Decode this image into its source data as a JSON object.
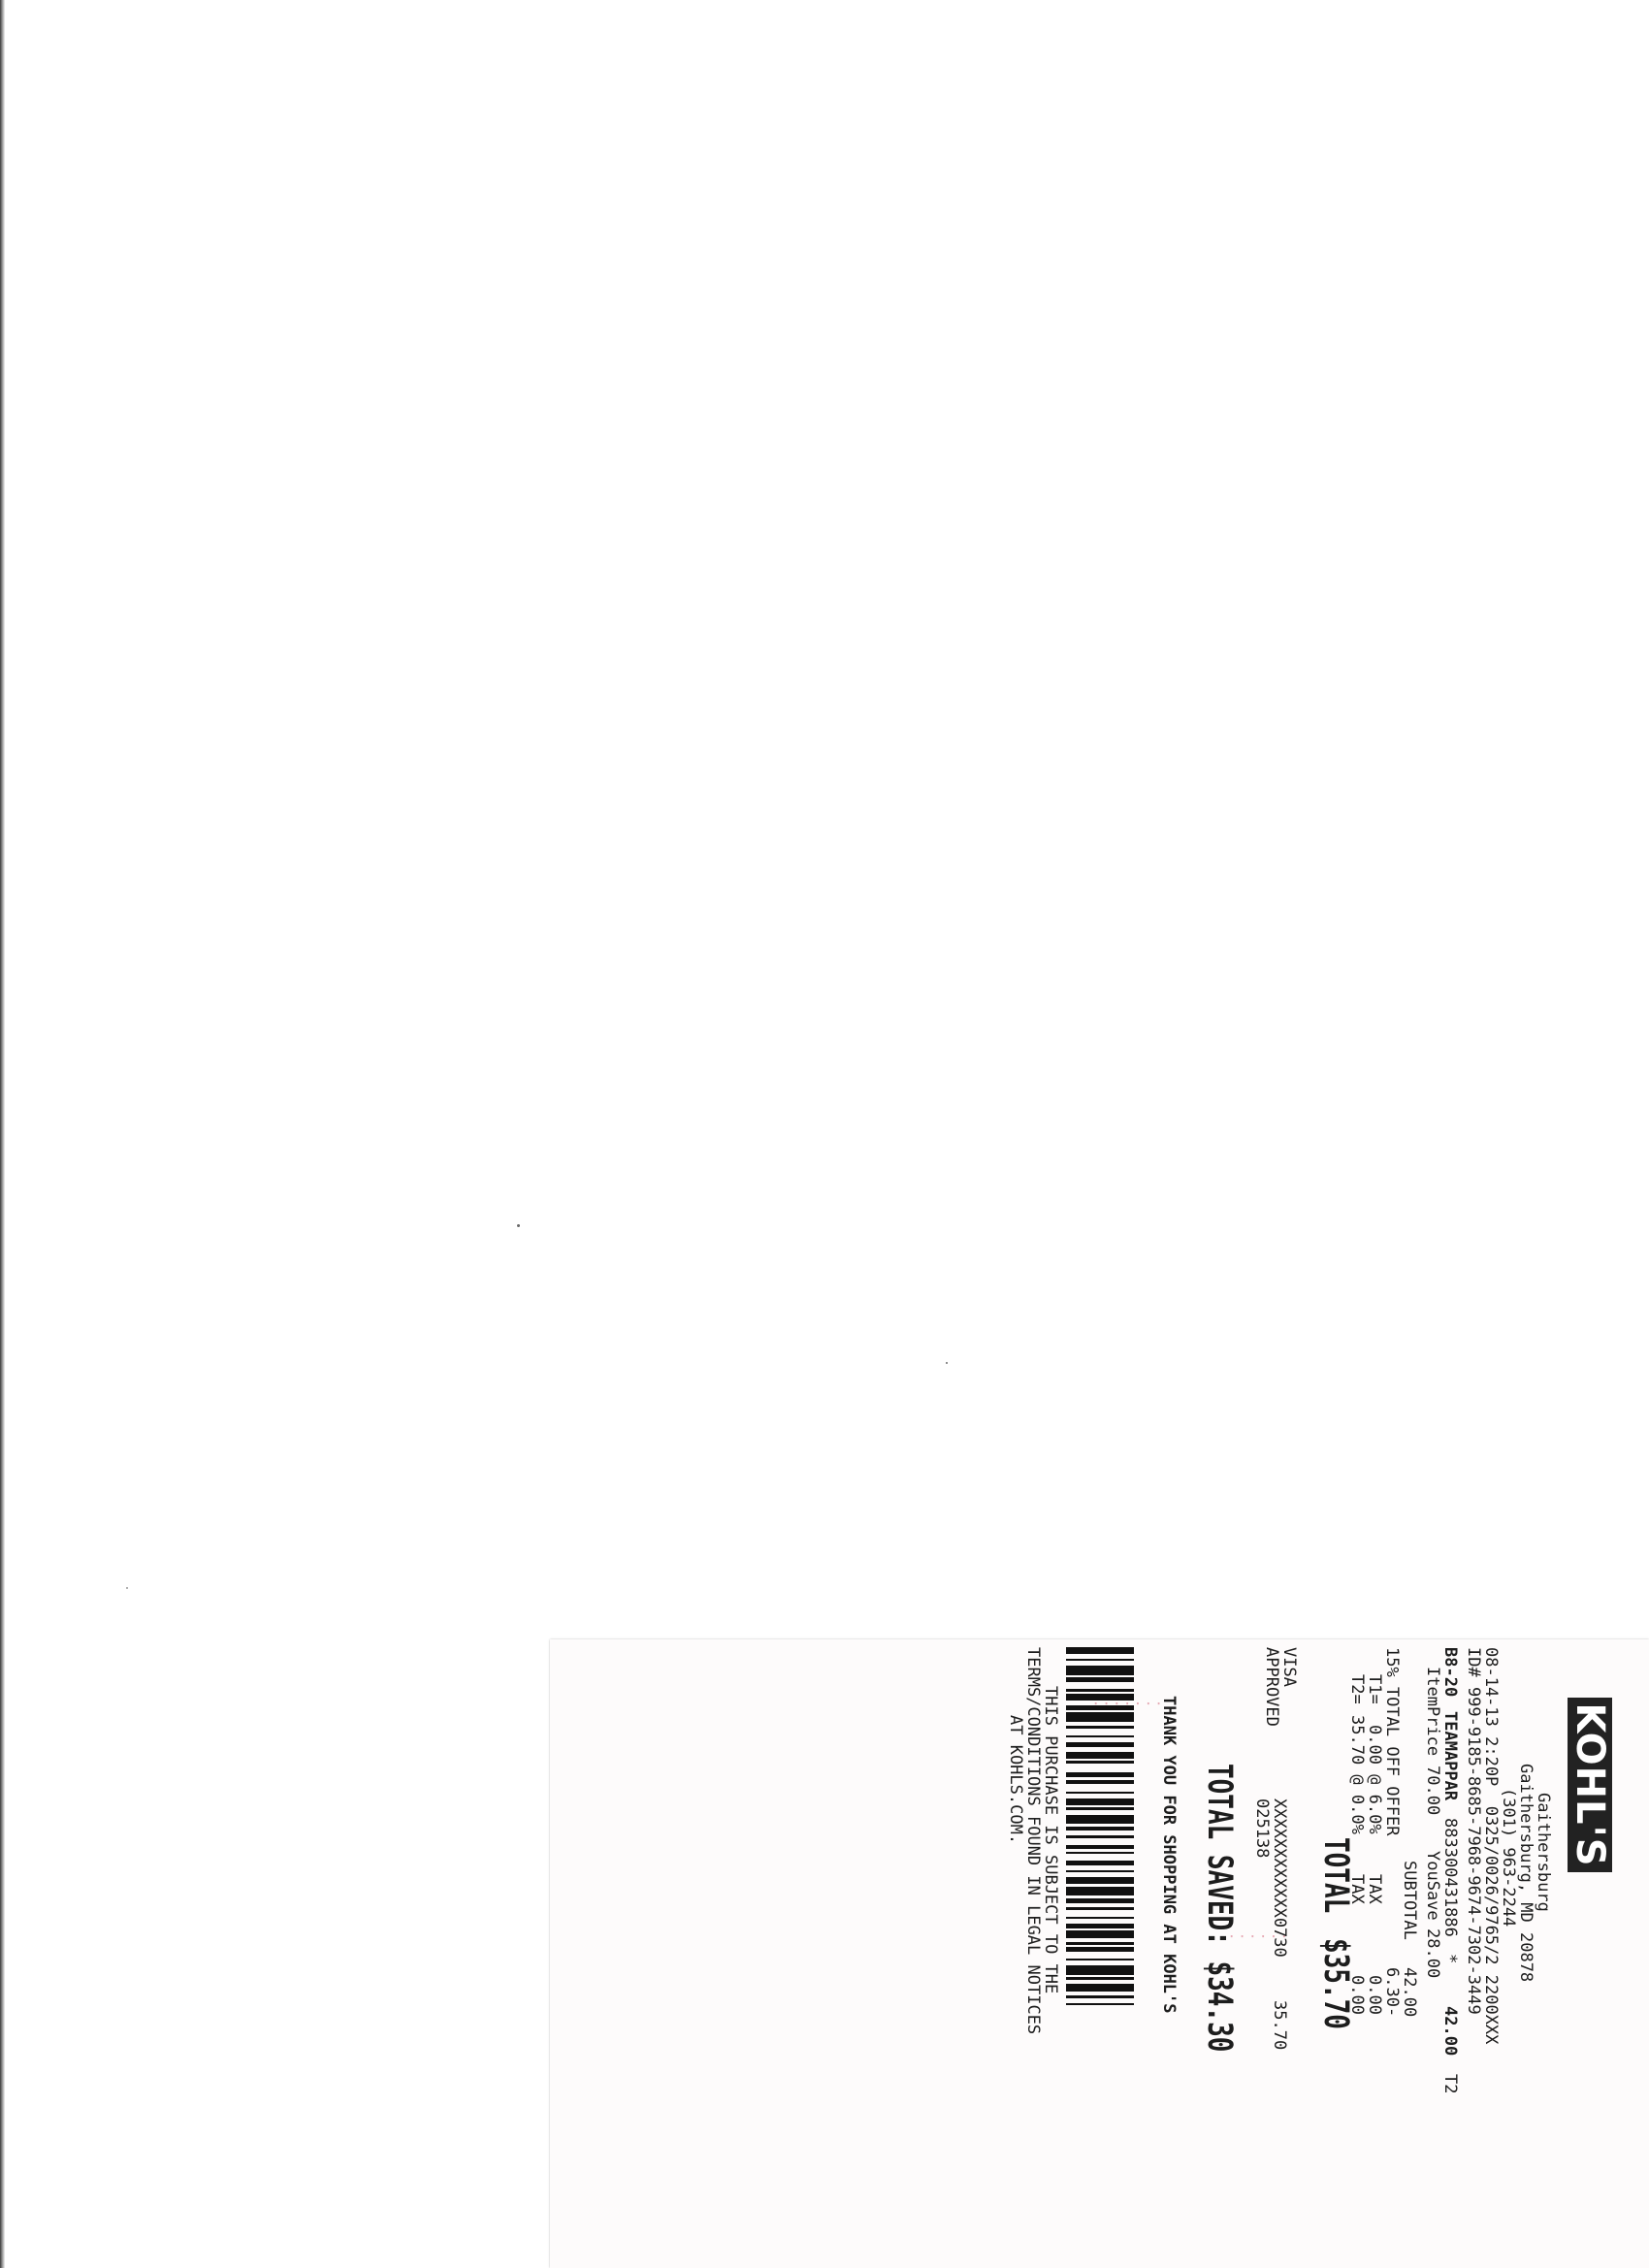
{
  "receipt": {
    "store_logo": "KOHL'S",
    "store_city": "Gaithersburg",
    "store_address": "Gaithersburg, MD 20878",
    "store_phone": "(301) 963-2244",
    "transaction_line": "08-14-13 2:20P  0325/0026/9765/2 2200XXX",
    "id_line": "ID# 999-9185-8685-7968-9674-7302-3449",
    "item": {
      "dept_code": "B8-20",
      "description": "TEAMAPPAR",
      "sku": "883300431886",
      "flag": "*",
      "price": "42.00",
      "tax_code": "T2",
      "item_price_label": "ItemPrice",
      "item_price": "70.00",
      "you_save_label": "YouSave",
      "you_save": "28.00"
    },
    "subtotal_label": "SUBTOTAL",
    "subtotal": "42.00",
    "discount_label": "15% TOTAL OFF OFFER",
    "discount": "6.30-",
    "t1_label": "T1=",
    "t1_base": "0.00 @ 6.0%",
    "t1_tax_label": "TAX",
    "t1_tax": "0.00",
    "t2_label": "T2=",
    "t2_base": "35.70 @ 0.0%",
    "t2_tax_label": "TAX",
    "t2_tax": "0.00",
    "total_label": "TOTAL",
    "total": "$35.70",
    "payment_method": "VISA",
    "card_number": "XXXXXXXXXXXX0730",
    "payment_amount": "35.70",
    "approval_label": "APPROVED",
    "approval_code": "025138",
    "total_saved": "TOTAL SAVED: $34.30",
    "thank_you": "THANK YOU FOR SHOPPING AT KOHL'S",
    "footer_1": "THIS PURCHASE IS SUBJECT TO THE",
    "footer_2": "TERMS/CONDITIONS FOUND IN LEGAL NOTICES",
    "footer_3": "AT KOHLS.COM."
  }
}
